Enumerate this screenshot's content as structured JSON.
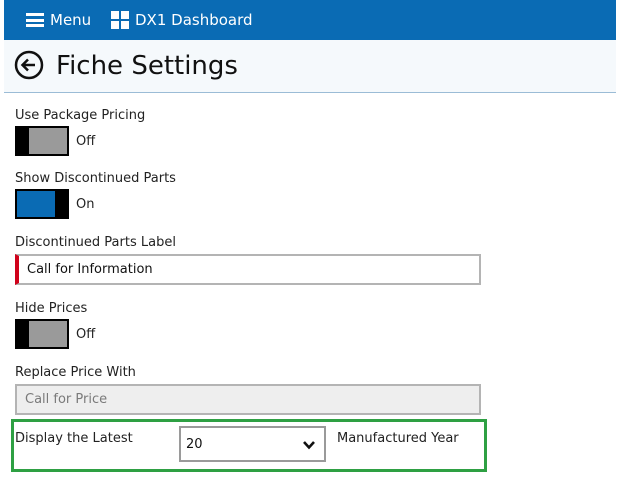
{
  "topbar": {
    "menu_label": "Menu",
    "dashboard_label": "DX1 Dashboard"
  },
  "header": {
    "title": "Fiche Settings"
  },
  "settings": {
    "package_pricing": {
      "label": "Use Package Pricing",
      "state": "Off"
    },
    "discontinued_parts": {
      "label": "Show Discontinued Parts",
      "state": "On"
    },
    "discontinued_label": {
      "label": "Discontinued Parts Label",
      "value": "Call for Information"
    },
    "hide_prices": {
      "label": "Hide Prices",
      "state": "Off"
    },
    "replace_price": {
      "label": "Replace Price With",
      "value": "Call for Price"
    },
    "display_latest": {
      "label": "Display the Latest",
      "selected": "20",
      "suffix": "Manufactured Year"
    }
  },
  "colors": {
    "topbar": "#0a6bb4",
    "toggle_on": "#0a6bb4",
    "toggle_off": "#9a9a9a",
    "required_marker": "#d0021b",
    "highlight": "#2ea043"
  }
}
